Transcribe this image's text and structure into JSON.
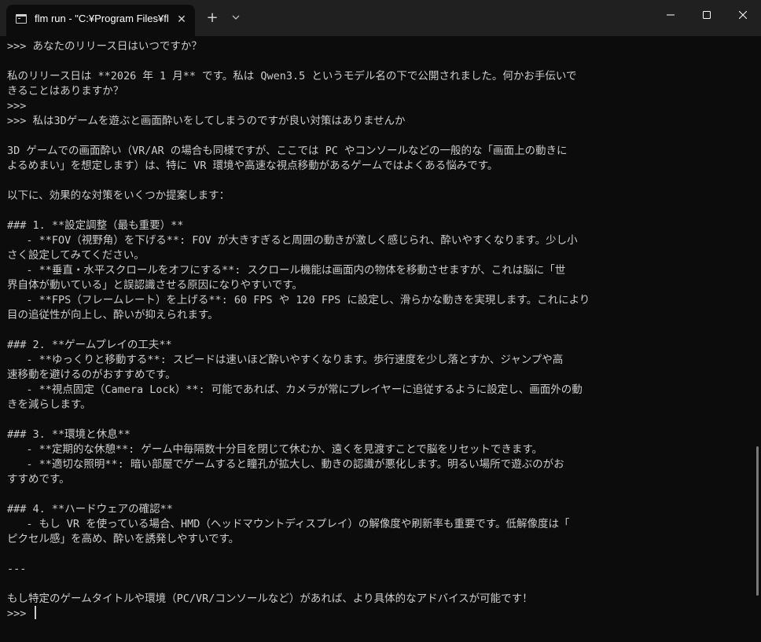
{
  "window": {
    "tab_title": "flm run - \"C:¥Program Files¥flm",
    "tab_close_glyph": "✕",
    "new_tab_glyph": "+"
  },
  "terminal": {
    "lines": [
      ">>> あなたのリリース日はいつですか？",
      "",
      "私のリリース日は **2026 年 1 月** です。私は Qwen3.5 というモデル名の下で公開されました。何かお手伝いで",
      "きることはありますか？",
      ">>>",
      ">>> 私は3Dゲームを遊ぶと画面酔いをしてしまうのですが良い対策はありませんか",
      "",
      "3D ゲームでの画面酔い（VR/AR の場合も同様ですが、ここでは PC やコンソールなどの一般的な「画面上の動きに",
      "よるめまい」を想定します）は、特に VR 環境や高速な視点移動があるゲームではよくある悩みです。",
      "",
      "以下に、効果的な対策をいくつか提案します：",
      "",
      "### 1. **設定調整（最も重要）**",
      "   - **FOV（視野角）を下げる**: FOV が大きすぎると周囲の動きが激しく感じられ、酔いやすくなります。少し小",
      "さく設定してみてください。",
      "   - **垂直・水平スクロールをオフにする**: スクロール機能は画面内の物体を移動させますが、これは脳に「世",
      "界自体が動いている」と誤認識させる原因になりやすいです。",
      "   - **FPS（フレームレート）を上げる**: 60 FPS や 120 FPS に設定し、滑らかな動きを実現します。これにより",
      "目の追従性が向上し、酔いが抑えられます。",
      "",
      "### 2. **ゲームプレイの工夫**",
      "   - **ゆっくりと移動する**: スピードは速いほど酔いやすくなります。歩行速度を少し落とすか、ジャンプや高",
      "速移動を避けるのがおすすめです。",
      "   - **視点固定（Camera Lock）**: 可能であれば、カメラが常にプレイヤーに追従するように設定し、画面外の動",
      "きを減らします。",
      "",
      "### 3. **環境と休息**",
      "   - **定期的な休憩**: ゲーム中毎隔数十分目を閉じて休むか、遠くを見渡すことで脳をリセットできます。",
      "   - **適切な照明**: 暗い部屋でゲームすると瞳孔が拡大し、動きの認識が悪化します。明るい場所で遊ぶのがお",
      "すすめです。",
      "",
      "### 4. **ハードウェアの確認**",
      "   - もし VR を使っている場合、HMD（ヘッドマウントディスプレイ）の解像度や刷新率も重要です。低解像度は「",
      "ピクセル感」を高め、酔いを誘発しやすいです。",
      "",
      "---",
      "",
      "もし特定のゲームタイトルや環境（PC/VR/コンソールなど）があれば、より具体的なアドバイスが可能です！",
      ">>>"
    ]
  },
  "colors": {
    "background": "#0c0c0c",
    "titlebar": "#202020",
    "text": "#cccccc"
  }
}
